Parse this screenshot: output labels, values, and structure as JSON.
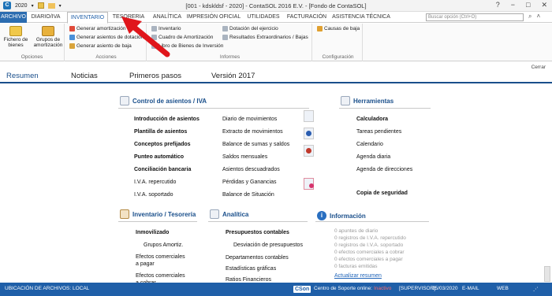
{
  "window": {
    "title": "[001 - kdskldsf - 2020] - ContaSOL 2016 E.V. - [Fondo de ContaSOL]",
    "year": "2020",
    "controls": [
      "?",
      "−",
      "□",
      "✕"
    ]
  },
  "menu": {
    "tabs": [
      "ARCHIVO",
      "DIARIO/IVA",
      "INVENTARIO",
      "TESORERIA",
      "ANALÍTICA",
      "IMPRESIÓN OFICIAL",
      "UTILIDADES",
      "FACTURACIÓN",
      "ASISTENCIA TÉCNICA"
    ],
    "search_placeholder": "Buscar opción (Ctrl+O)"
  },
  "ribbon": {
    "opciones": {
      "label": "Opciones",
      "fichero": "Fichero de bienes",
      "grupos": "Grupos de amortización"
    },
    "acciones": {
      "label": "Acciones",
      "btn1": "Generar amortización",
      "btn2": "Generar asientos de dotación",
      "btn3": "Generar asiento de baja"
    },
    "informes": {
      "label": "Informes",
      "btn1": "Inventario",
      "btn2": "Cuadro de Amortización",
      "btn3": "Libro de Bienes de Inversión",
      "btn4": "Dotación del ejercicio",
      "btn5": "Resultados Extraordinarios / Bajas"
    },
    "configuracion": {
      "label": "Configuración",
      "btn1": "Causas de baja"
    }
  },
  "nav": {
    "tabs": [
      "Resumen",
      "Noticias",
      "Primeros pasos",
      "Versión 2017"
    ],
    "close": "Cerrar"
  },
  "control": {
    "title": "Control de asientos / IVA",
    "col1": [
      "Introducción de asientos",
      "Plantilla de asientos",
      "Conceptos prefijados",
      "Punteo automático",
      "Conciliación bancaria",
      "I.V.A. repercutido",
      "I.V.A. soportado"
    ],
    "col2": [
      "Diario de movimientos",
      "Extracto de movimientos",
      "Balance de sumas y saldos",
      "Saldos mensuales",
      "Asientos descuadrados",
      "Pérdidas y Ganancias",
      "Balance de Situación"
    ]
  },
  "herramientas": {
    "title": "Herramientas",
    "items": [
      "Calculadora",
      "Tareas pendientes",
      "Calendario",
      "Agenda diaria",
      "Agenda de direcciones",
      "Copia de seguridad"
    ]
  },
  "inventario": {
    "title": "Inventario / Tesorería",
    "items": [
      "Inmovilizado",
      "Grupos Amortiz.",
      "Efectos comerciales a pagar",
      "Efectos comerciales a cobrar"
    ]
  },
  "analitica": {
    "title": "Analítica",
    "items": [
      "Presupuestos contables",
      "Desviación de presupuestos",
      "Departamentos contables",
      "Estadísticas gráficas",
      "Ratios Financieros"
    ]
  },
  "informacion": {
    "title": "Información",
    "items": [
      "0 apuntes de diario",
      "0 registros de I.V.A. repercutido",
      "0 registros de I.V.A. soportado",
      "0 efectos comerciales a cobrar",
      "0 efectos comerciales a pagar",
      "0 facturas emitidas"
    ],
    "link": "Actualizar resumen"
  },
  "status": {
    "left": "UBICACIÓN DE ARCHIVOS: LOCAL",
    "cson": "CSon",
    "soporte": "Centro de Soporte online:",
    "estado": "Inactivo",
    "user": "[SUPERVISOR]",
    "date": "25/03/2020",
    "email": "E-MAIL",
    "web": "WEB"
  },
  "colors": {
    "accent": "#1f5fa8",
    "heading": "#1a4f8b",
    "arrow": "#e0161b"
  }
}
